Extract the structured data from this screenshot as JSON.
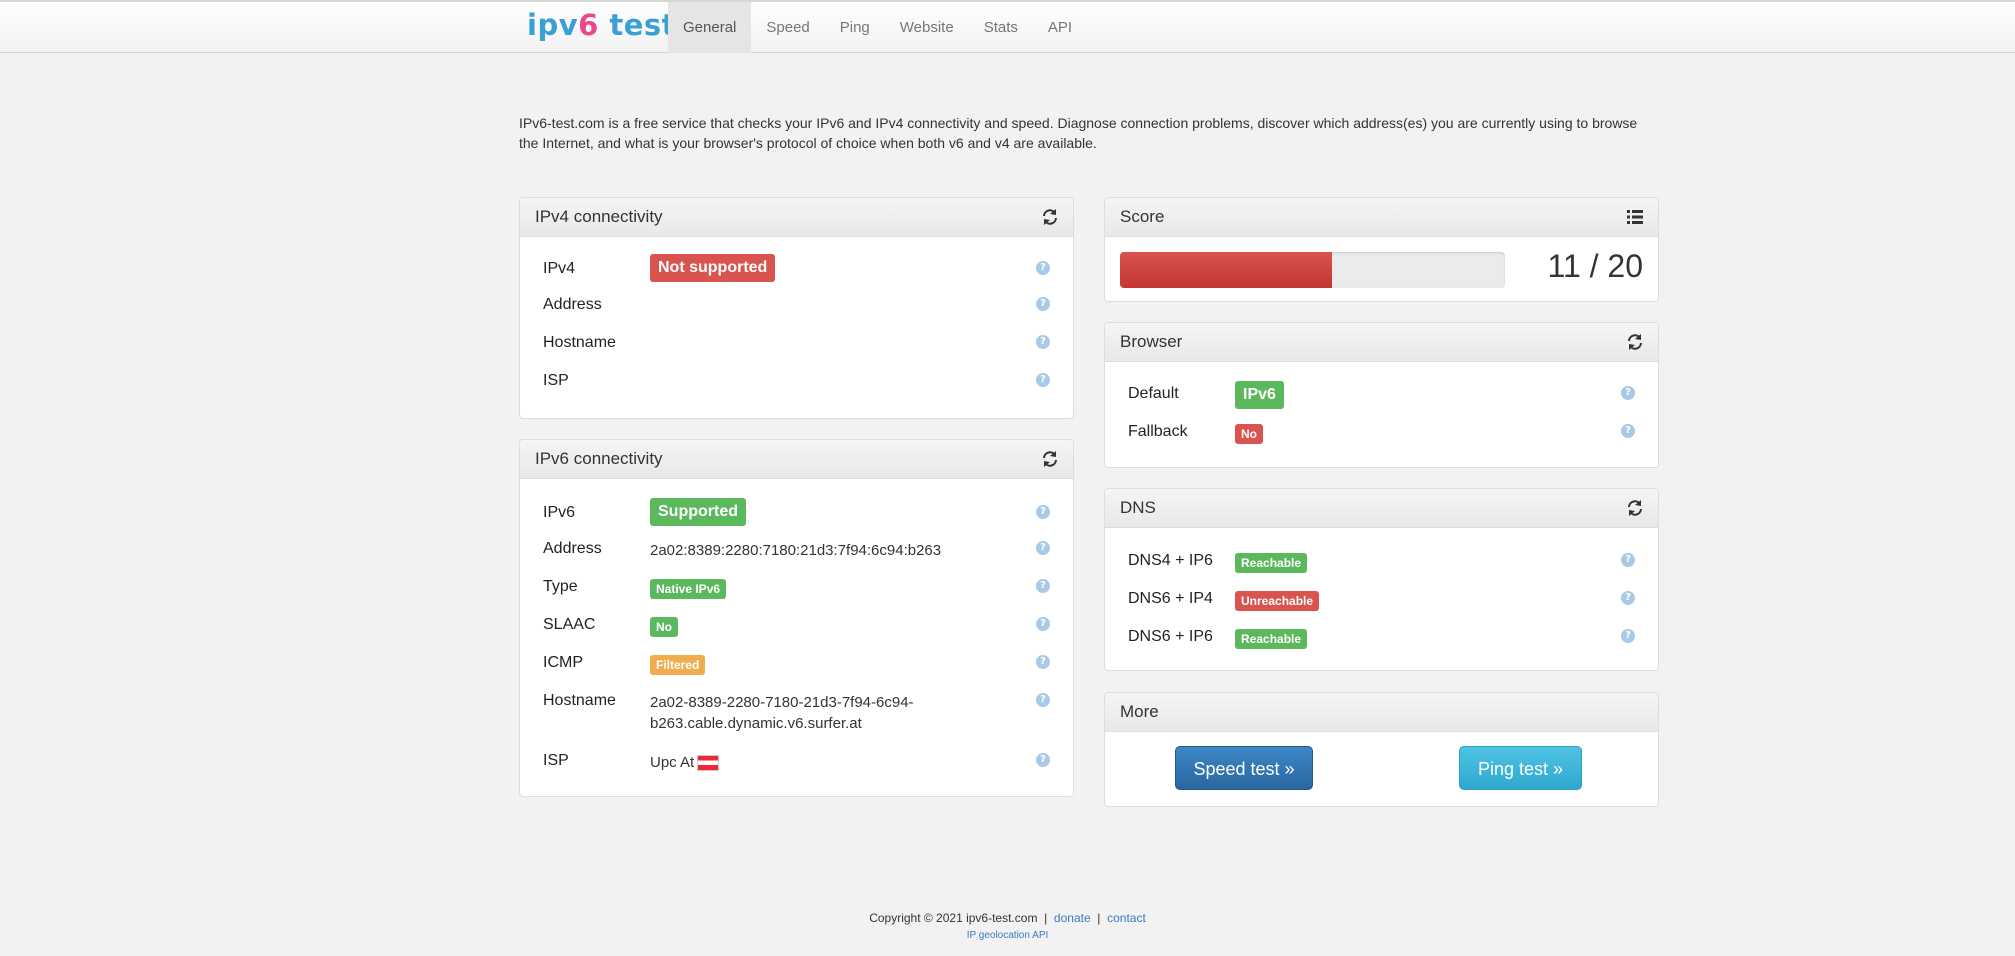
{
  "brand": {
    "part1": "ipv",
    "part2": "6",
    "part3": " test"
  },
  "nav": [
    "General",
    "Speed",
    "Ping",
    "Website",
    "Stats",
    "API"
  ],
  "intro": "IPv6-test.com is a free service that checks your IPv6 and IPv4 connectivity and speed. Diagnose connection problems, discover which address(es) you are currently using to browse the Internet, and what is your browser's protocol of choice when both v6 and v4 are available.",
  "ipv4": {
    "title": "IPv4 connectivity",
    "rows": [
      {
        "label": "IPv4",
        "value": "Not supported"
      },
      {
        "label": "Address",
        "value": ""
      },
      {
        "label": "Hostname",
        "value": ""
      },
      {
        "label": "ISP",
        "value": ""
      }
    ]
  },
  "ipv6": {
    "title": "IPv6 connectivity",
    "rows": [
      {
        "label": "IPv6",
        "value": "Supported"
      },
      {
        "label": "Address",
        "value": "2a02:8389:2280:7180:21d3:7f94:6c94:b263"
      },
      {
        "label": "Type",
        "value": "Native IPv6"
      },
      {
        "label": "SLAAC",
        "value": "No"
      },
      {
        "label": "ICMP",
        "value": "Filtered"
      },
      {
        "label": "Hostname",
        "value": "2a02-8389-2280-7180-21d3-7f94-6c94-",
        "value2": "b263.cable.dynamic.v6.surfer.at"
      },
      {
        "label": "ISP",
        "value": "Upc At"
      }
    ]
  },
  "score": {
    "title": "Score",
    "value": 11,
    "max": 20,
    "text": "11 / 20",
    "fraction": 0.55
  },
  "browser": {
    "title": "Browser",
    "rows": [
      {
        "label": "Default",
        "value": "IPv6"
      },
      {
        "label": "Fallback",
        "value": "No"
      }
    ]
  },
  "dns": {
    "title": "DNS",
    "rows": [
      {
        "label": "DNS4 + IP6",
        "value": "Reachable"
      },
      {
        "label": "DNS6 + IP4",
        "value": "Unreachable"
      },
      {
        "label": "DNS6 + IP6",
        "value": "Reachable"
      }
    ]
  },
  "more": {
    "title": "More",
    "speed_button": "Speed test »",
    "ping_button": "Ping test »"
  },
  "footer": {
    "copyright": "Copyright © 2021 ipv6-test.com",
    "sep": "|",
    "donate": "donate",
    "contact": "contact",
    "geo": "IP geolocation API"
  },
  "colors": {
    "red": "#d9534f",
    "green": "#5cb85c",
    "orange": "#f0ad4e",
    "link": "#3a7bbf"
  }
}
